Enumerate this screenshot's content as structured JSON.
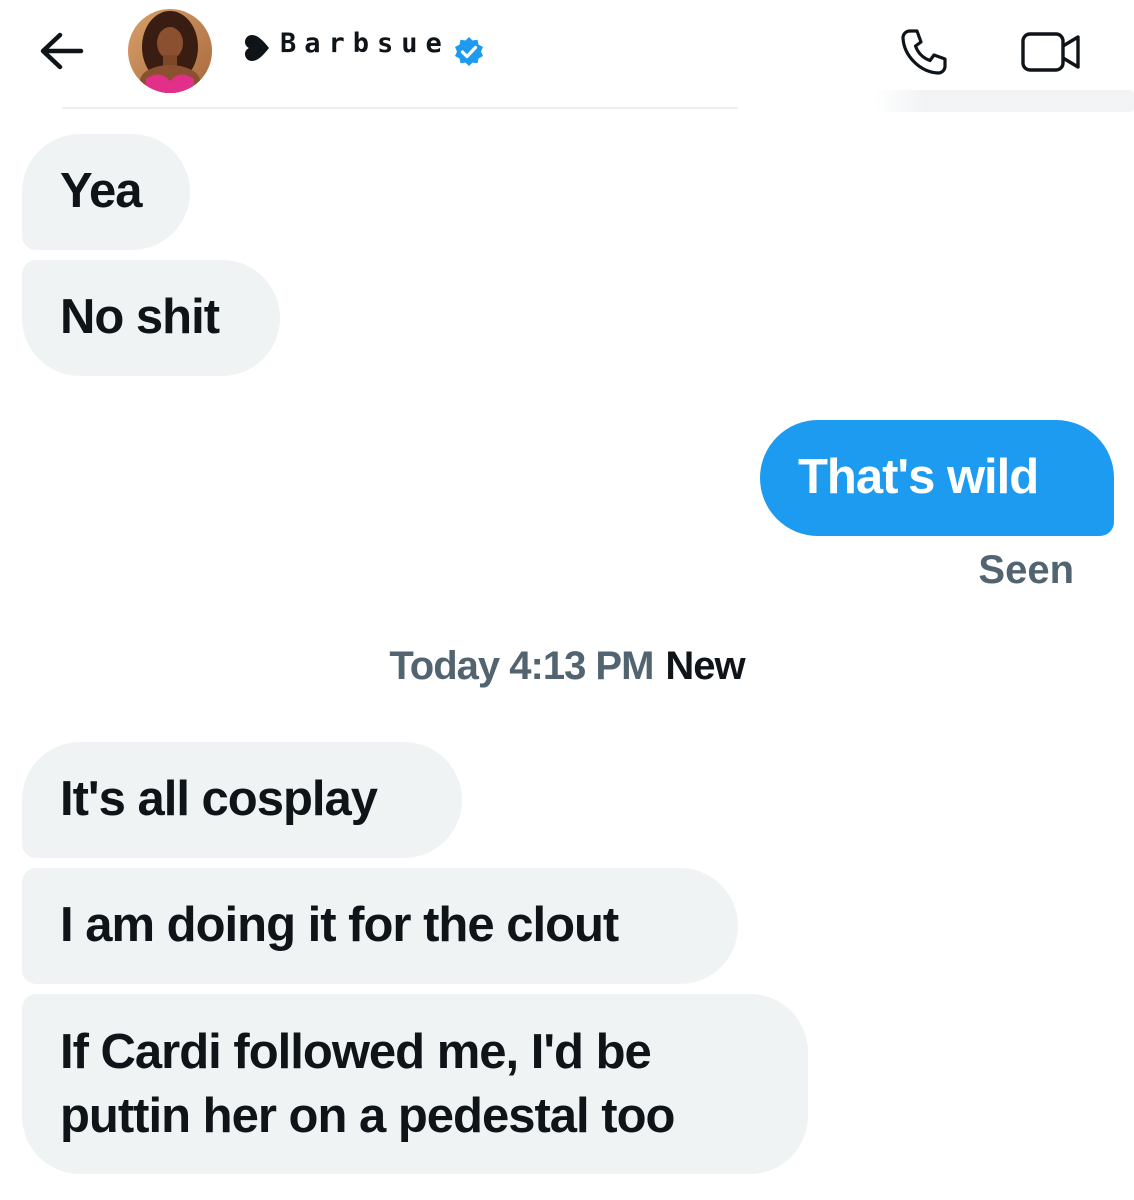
{
  "header": {
    "display_name": "Barbsue",
    "icons": {
      "back": "arrow-left-icon",
      "heart": "heart-icon",
      "verified": "verified-badge-icon",
      "call": "phone-icon",
      "video": "video-camera-icon"
    }
  },
  "messages": [
    {
      "direction": "received",
      "text": "Yea"
    },
    {
      "direction": "received",
      "text": "No shit"
    },
    {
      "direction": "sent",
      "text": "That's wild"
    },
    {
      "direction": "received",
      "text": "It's all cosplay"
    },
    {
      "direction": "received",
      "text": "I am doing it for the clout"
    },
    {
      "direction": "received",
      "text": "If Cardi followed me, I'd be puttin her on a pedestal too"
    }
  ],
  "seen_label": "Seen",
  "divider": {
    "time_label": "Today 4:13 PM",
    "new_label": "New"
  },
  "colors": {
    "sent_bubble": "#1d9bf0",
    "received_bubble": "#eff3f4",
    "verified": "#1d9bf0",
    "text": "#0f1419",
    "muted": "#536471"
  }
}
